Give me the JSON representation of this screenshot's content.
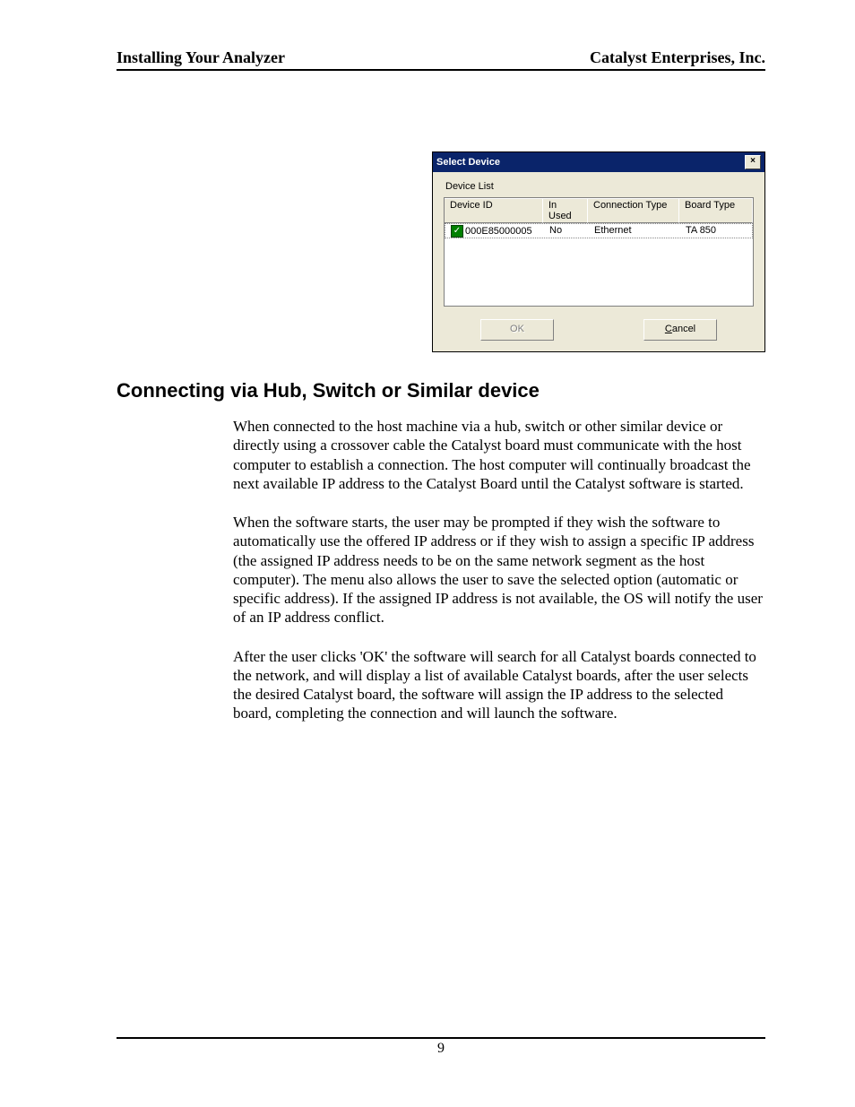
{
  "header": {
    "left": "Installing Your Analyzer",
    "right": "Catalyst Enterprises, Inc."
  },
  "dialog": {
    "title": "Select Device",
    "close_glyph": "×",
    "list_label": "Device List",
    "columns": {
      "c1": "Device ID",
      "c2": "In Used",
      "c3": "Connection Type",
      "c4": "Board Type"
    },
    "row": {
      "check": "✓",
      "device_id": "000E85000005",
      "in_used": "No",
      "conn_type": "Ethernet",
      "board_type": "TA 850"
    },
    "buttons": {
      "ok": "OK",
      "cancel": "Cancel"
    }
  },
  "section_title": "Connecting via Hub, Switch or Similar device",
  "paragraphs": {
    "p1": "When connected to the host machine via a hub, switch or other similar device or directly using a crossover cable the Catalyst board must communicate with the host computer to establish a connection. The host computer will continually broadcast the next available IP address to the Catalyst Board until the Catalyst software is started.",
    "p2": "When the software starts, the user may be prompted if they wish the software to automatically use the offered IP address or if they wish to assign a specific IP address (the assigned IP address needs to be on the same network segment as the host computer). The menu also allows the user to save the selected option (automatic or specific address). If the assigned IP address is not available, the OS will notify the user of an IP address conflict.",
    "p3": "After the user clicks 'OK' the software will search for all Catalyst boards connected to the network, and will display a list of available Catalyst boards, after the user selects the desired Catalyst board, the software will assign the IP address to the selected board, completing the connection and will launch the software."
  },
  "page_number": "9"
}
